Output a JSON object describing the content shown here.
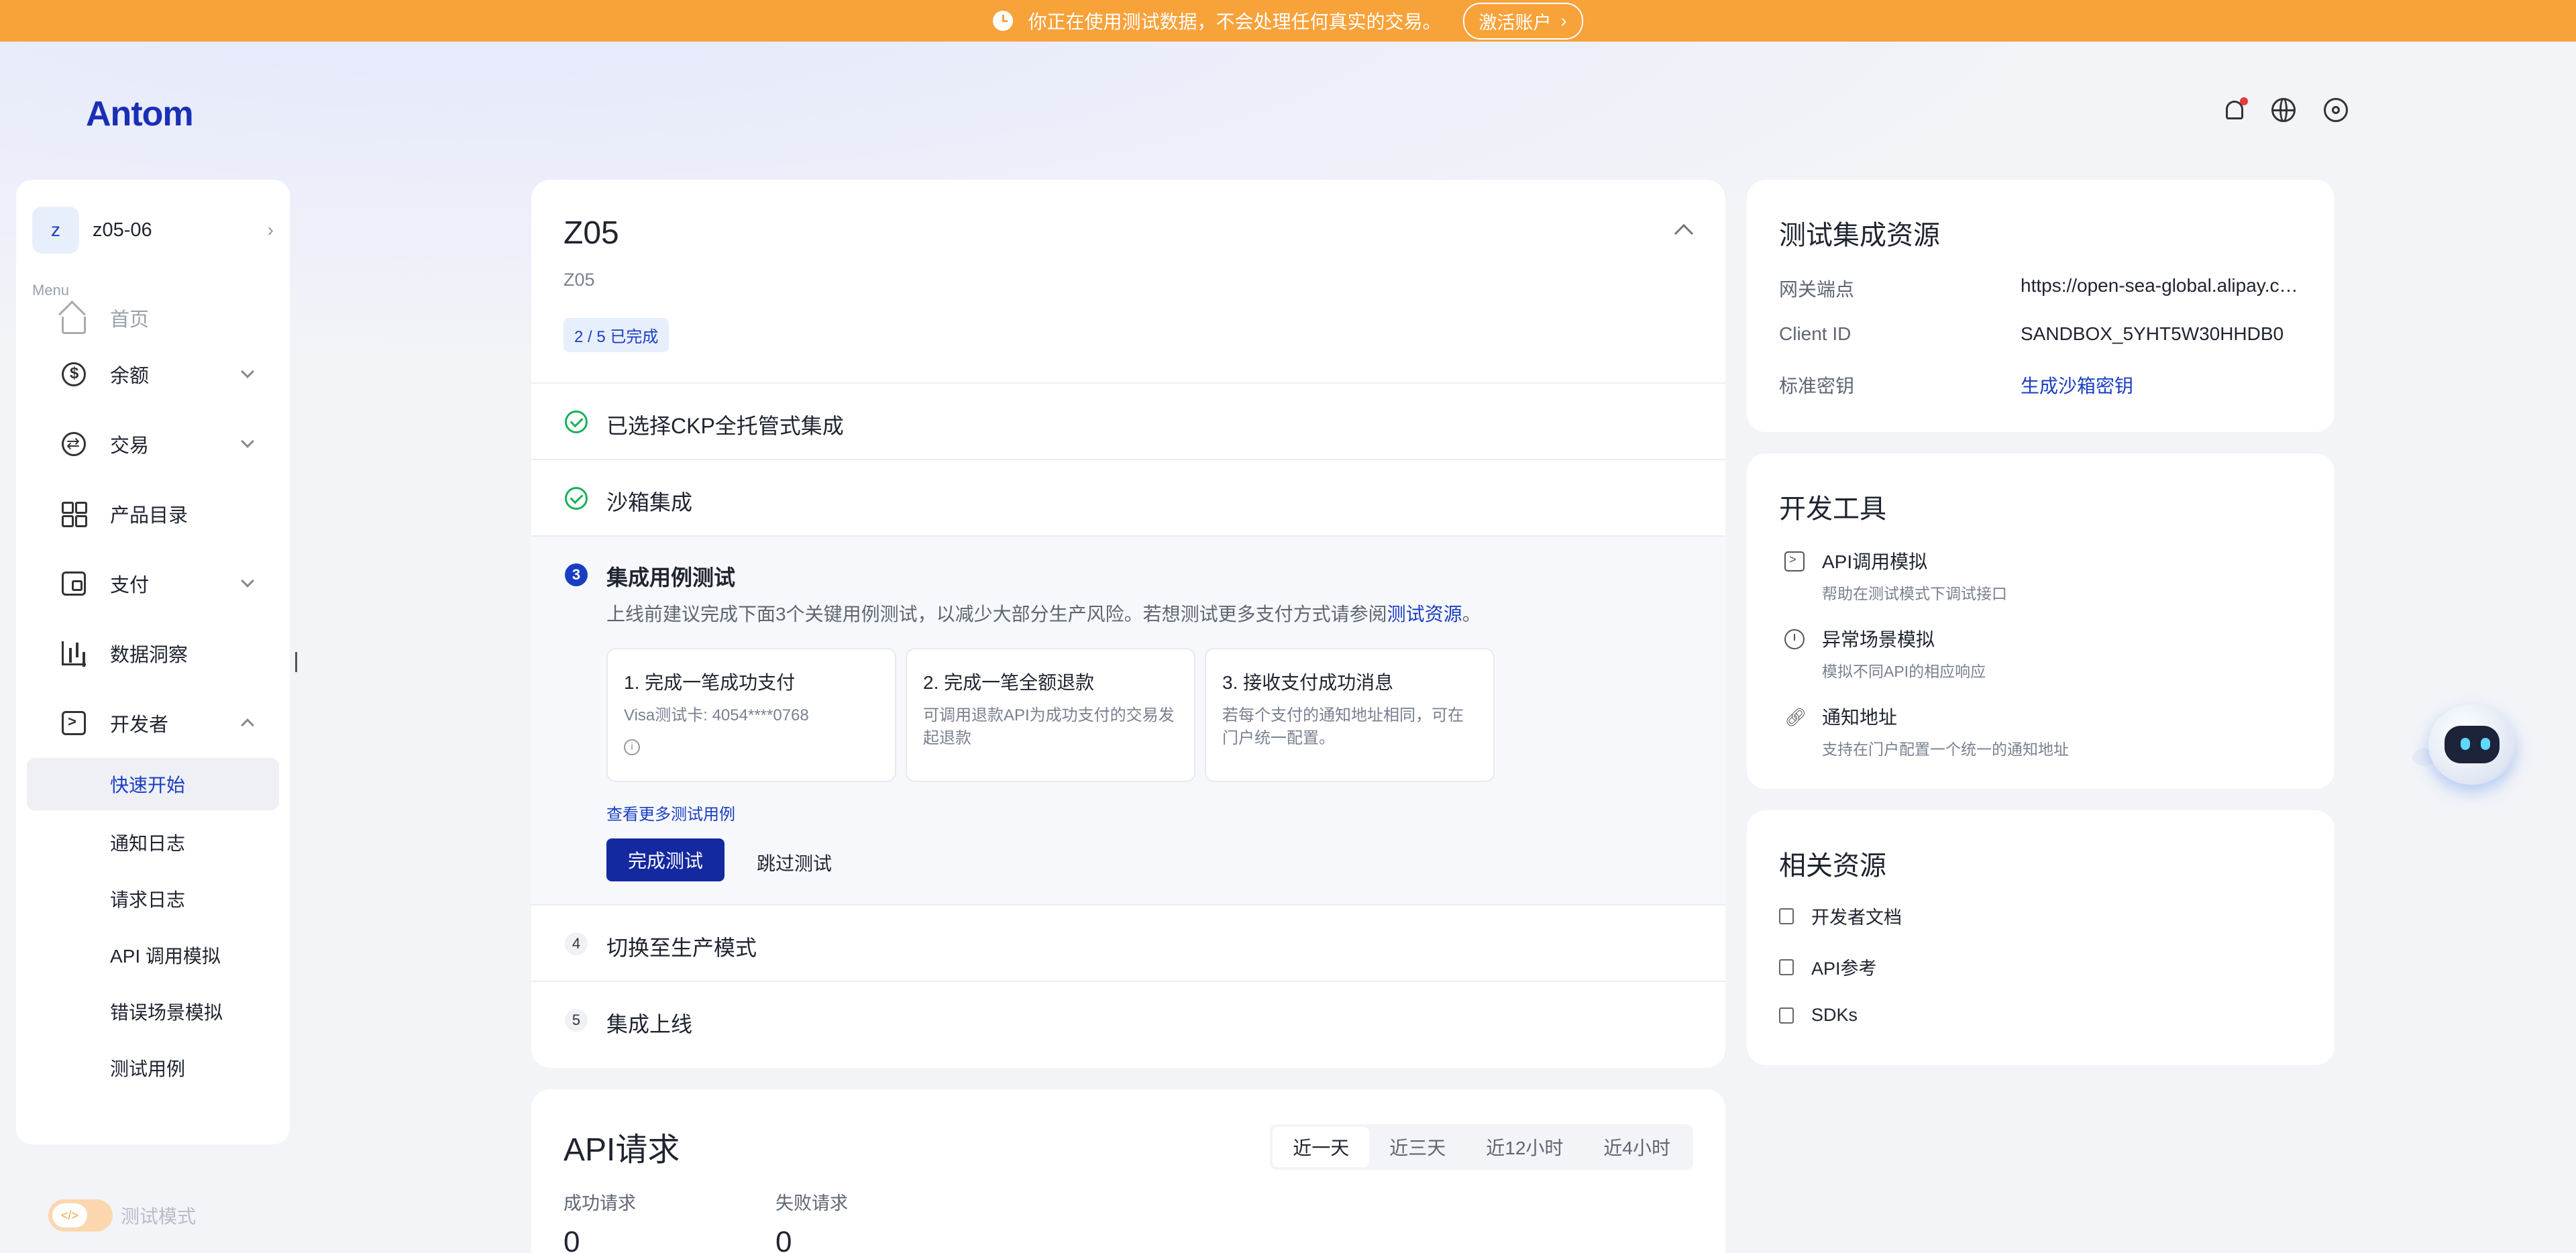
{
  "banner": {
    "message": "你正在使用测试数据，不会处理任何真实的交易。",
    "activate_label": "激活账户"
  },
  "header": {
    "logo": "Antom"
  },
  "sidebar": {
    "account_avatar": "z",
    "account_name": "z05-06",
    "menu_label": "Menu",
    "items": [
      {
        "label": "首页"
      },
      {
        "label": "余额"
      },
      {
        "label": "交易"
      },
      {
        "label": "产品目录"
      },
      {
        "label": "支付"
      },
      {
        "label": "数据洞察"
      },
      {
        "label": "开发者"
      }
    ],
    "developer_sub": [
      {
        "label": "快速开始"
      },
      {
        "label": "通知日志"
      },
      {
        "label": "请求日志"
      },
      {
        "label": "API 调用模拟"
      },
      {
        "label": "错误场景模拟"
      },
      {
        "label": "测试用例"
      }
    ],
    "test_mode_label": "测试模式"
  },
  "integration": {
    "title": "Z05",
    "subtitle": "Z05",
    "progress_badge": "2 / 5 已完成",
    "steps": [
      {
        "title": "已选择CKP全托管式集成"
      },
      {
        "title": "沙箱集成"
      },
      {
        "num": "3",
        "title": "集成用例测试"
      },
      {
        "num": "4",
        "title": "切换至生产模式"
      },
      {
        "num": "5",
        "title": "集成上线"
      }
    ],
    "step3": {
      "desc_before": "上线前建议完成下面3个关键用例测试，以减少大部分生产风险。若想测试更多支付方式请参阅",
      "desc_link": "测试资源",
      "desc_after": "。",
      "cases": [
        {
          "title": "1. 完成一笔成功支付",
          "desc": "Visa测试卡: 4054****0768"
        },
        {
          "title": "2. 完成一笔全额退款",
          "desc": "可调用退款API为成功支付的交易发起退款"
        },
        {
          "title": "3. 接收支付成功消息",
          "desc": "若每个支付的通知地址相同，可在门户统一配置。"
        }
      ],
      "more_link": "查看更多测试用例",
      "complete_button": "完成测试",
      "skip_button": "跳过测试"
    }
  },
  "test_resources": {
    "title": "测试集成资源",
    "rows": [
      {
        "key": "网关端点",
        "value": "https://open-sea-global.alipay.com"
      },
      {
        "key": "Client ID",
        "value": "SANDBOX_5YHT5W30HHDB0"
      },
      {
        "key": "标准密钥",
        "value": "生成沙箱密钥"
      }
    ]
  },
  "dev_tools": {
    "title": "开发工具",
    "items": [
      {
        "title": "API调用模拟",
        "desc": "帮助在测试模式下调试接口"
      },
      {
        "title": "异常场景模拟",
        "desc": "模拟不同API的相应响应"
      },
      {
        "title": "通知地址",
        "desc": "支持在门户配置一个统一的通知地址"
      }
    ]
  },
  "related": {
    "title": "相关资源",
    "items": [
      {
        "label": "开发者文档"
      },
      {
        "label": "API参考"
      },
      {
        "label": "SDKs"
      }
    ]
  },
  "api_requests": {
    "title": "API请求",
    "tabs": [
      "近一天",
      "近三天",
      "近12小时",
      "近4小时"
    ],
    "success_label": "成功请求",
    "success_value": "0",
    "fail_label": "失败请求",
    "fail_value": "0"
  },
  "colors": {
    "brand": "#1a3ec2",
    "banner": "#f8a23a",
    "success": "#18b05a"
  }
}
